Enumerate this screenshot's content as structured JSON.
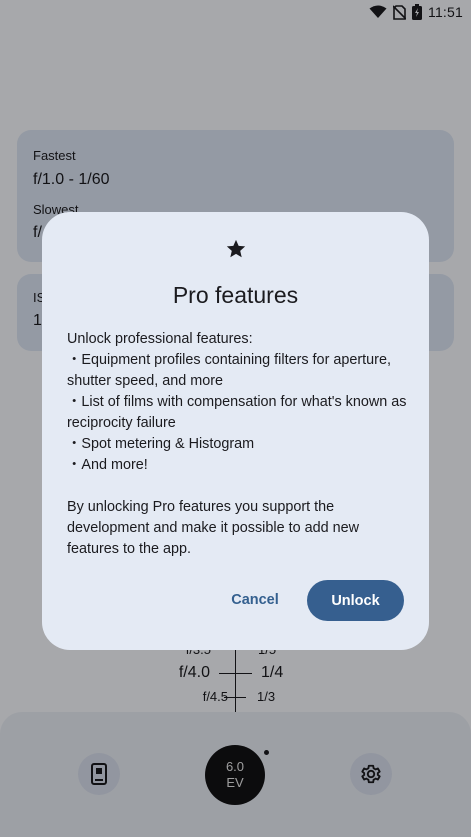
{
  "status_bar": {
    "time": "11:51"
  },
  "cards": {
    "fastest_label": "Fastest",
    "fastest_value": "f/1.0 - 1/60",
    "slowest_label": "Slowest",
    "slowest_value": "f/",
    "iso_label": "IS",
    "iso_value": "1"
  },
  "scale": {
    "rows": [
      {
        "aperture": "f/3.5",
        "shutter": "1/5"
      },
      {
        "aperture": "f/4.0",
        "shutter": "1/4"
      },
      {
        "aperture": "f/4.5",
        "shutter": "1/3"
      }
    ]
  },
  "bottom_bar": {
    "ev_value": "6.0",
    "ev_unit": "EV"
  },
  "dialog": {
    "icon": "star-icon",
    "title": "Pro features",
    "body": "Unlock professional features:\n・Equipment profiles containing filters for aperture, shutter speed, and more\n・List of films with compensation for what's known as reciprocity failure\n・Spot metering & Histogram\n・And more!\n\nBy unlocking Pro features you support the development and make it possible to add new features to the app.",
    "cancel_label": "Cancel",
    "unlock_label": "Unlock"
  },
  "colors": {
    "accent": "#365f8f",
    "card": "#dbe3f2",
    "dialog": "#e4eaf4"
  }
}
